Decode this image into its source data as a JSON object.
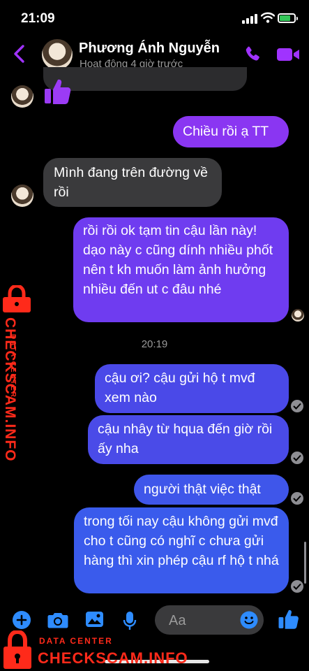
{
  "status_bar": {
    "time": "21:09"
  },
  "header": {
    "contact_name": "Phương Ánh Nguyễn",
    "contact_status": "Hoạt động 4 giờ trước",
    "accent_color": "#a033ff"
  },
  "messages": [
    {
      "direction": "outgoing",
      "text": "Chiều rồi ạ TT",
      "color": "#8a36f2"
    },
    {
      "direction": "incoming",
      "text": "Mình đang trên đường về rồi",
      "color": "#3a3a3c"
    },
    {
      "direction": "outgoing",
      "text": "rồi rồi ok tạm tin cậu lần này! dạo này c cũng dính nhiều phốt nên t kh muốn làm ảnh hưởng nhiều đến ut c đâu nhé",
      "color": "#6f3cf0"
    },
    {
      "direction": "outgoing",
      "text": "cậu ơi? cậu gửi hộ t mvđ xem nào",
      "color": "#4a49e8"
    },
    {
      "direction": "outgoing",
      "text": "cậu nhây từ hqua đến giờ rồi ấy nha",
      "color": "#4a4be8"
    },
    {
      "direction": "outgoing",
      "text": "người thật việc thật",
      "color": "#3f56ea"
    },
    {
      "direction": "outgoing",
      "text": "trong tối nay cậu không gửi mvđ cho t cũng có nghĩ c chưa gửi hàng thì xin phép cậu rf hộ t nhá",
      "color": "#3a5bec"
    }
  ],
  "timestamp": "20:19",
  "composer": {
    "placeholder": "Aa"
  },
  "watermark": {
    "title": "DATA CENTER",
    "brand": "CHECKSCAM.INFO",
    "color": "#ff2a1a"
  }
}
